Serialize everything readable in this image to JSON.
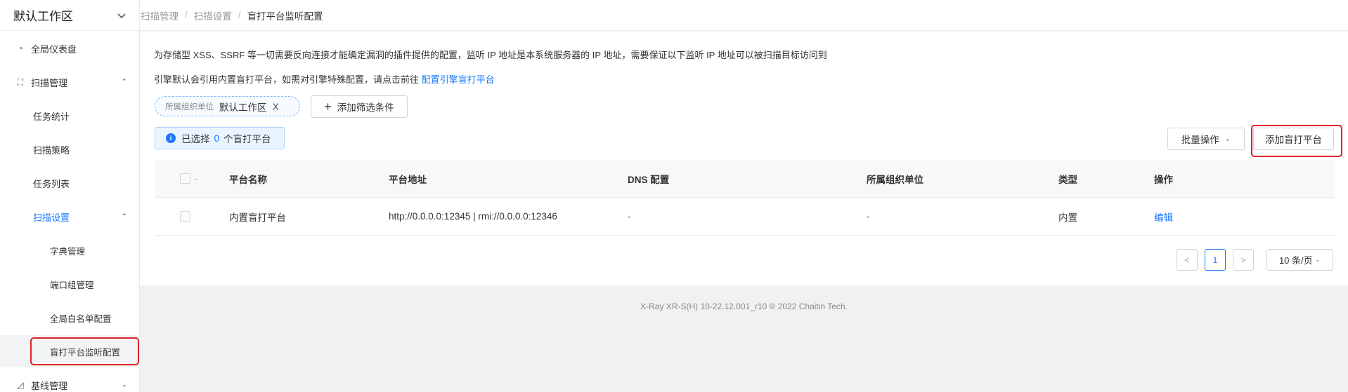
{
  "workspace": {
    "label": "默认工作区"
  },
  "breadcrumb": [
    "扫描管理",
    "扫描设置",
    "盲打平台监听配置"
  ],
  "sidebar": {
    "items": [
      {
        "label": "全局仪表盘"
      },
      {
        "label": "扫描管理"
      },
      {
        "label": "任务统计"
      },
      {
        "label": "扫描策略"
      },
      {
        "label": "任务列表"
      },
      {
        "label": "扫描设置"
      },
      {
        "label": "字典管理"
      },
      {
        "label": "端口组管理"
      },
      {
        "label": "全局白名单配置"
      },
      {
        "label": "盲打平台监听配置"
      },
      {
        "label": "基线管理"
      }
    ]
  },
  "main": {
    "desc1": "为存储型 XSS、SSRF 等一切需要反向连接才能确定漏洞的插件提供的配置，监听 IP 地址是本系统服务器的 IP 地址，需要保证以下监听 IP 地址可以被扫描目标访问到",
    "desc2_prefix": "引擎默认会引用内置盲打平台，如需对引擎特殊配置，请点击前往",
    "desc2_link": "配置引擎盲打平台",
    "filter_chip": {
      "label": "所属组织单位",
      "value": "默认工作区",
      "close": "X"
    },
    "add_filter_label": "添加筛选条件",
    "selected": {
      "prefix": "已选择",
      "count": "0",
      "suffix": "个盲打平台"
    },
    "batch_label": "批量操作",
    "add_button_label": "添加盲打平台"
  },
  "table": {
    "columns": [
      "平台名称",
      "平台地址",
      "DNS 配置",
      "所属组织单位",
      "类型",
      "操作"
    ],
    "rows": [
      {
        "name": "内置盲打平台",
        "address": "http://0.0.0.0:12345 | rmi://0.0.0.0:12346",
        "dns": "-",
        "org": "-",
        "type": "内置",
        "action": "编辑"
      }
    ]
  },
  "pagination": {
    "prev": "<",
    "page": "1",
    "next": ">",
    "page_size": "10 条/页"
  },
  "footer": "X-Ray XR-S(H) 10-22.12.001_r10 © 2022 Chaitin Tech.",
  "colors": {
    "accent": "#1677ff",
    "highlight": "#e0222a"
  }
}
